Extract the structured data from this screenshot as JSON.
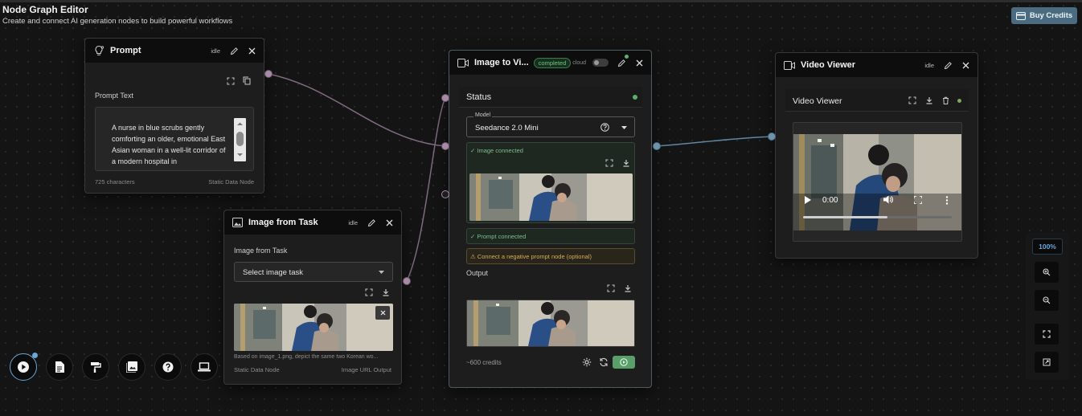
{
  "header": {
    "title": "Node Graph Editor",
    "subtitle": "Create and connect AI generation nodes to build powerful workflows",
    "buy_credits_label": "Buy Credits"
  },
  "prompt_node": {
    "title": "Prompt",
    "status": "idle",
    "section_label": "Prompt Text",
    "text_value": "A nurse in blue scrubs gently comforting an older, emotional East Asian woman in a well-lit corridor of a modern hospital in",
    "char_count": "725 characters",
    "footer_type": "Static Data Node"
  },
  "image_from_task_node": {
    "title": "Image from Task",
    "status": "idle",
    "section_label": "Image from Task",
    "select_value": "Select image task",
    "caption": "Based on image_1.png, depict the same two Korean wo...",
    "footer_left": "Static Data Node",
    "footer_right": "Image URL Output"
  },
  "image_to_video_node": {
    "title": "Image to Vi...",
    "status_badge": "completed",
    "cloud_label": "cloud",
    "status_label": "Status",
    "model_label": "Model",
    "model_value": "Seedance 2.0 Mini",
    "image_connected": "✓ Image connected",
    "prompt_connected": "✓ Prompt connected",
    "negative_prompt_hint": "⚠ Connect a negative prompt node (optional)",
    "output_label": "Output",
    "credits": "~600 credits"
  },
  "video_viewer_node": {
    "title": "Video Viewer",
    "status": "idle",
    "inner_title": "Video Viewer",
    "time": "0:00",
    "playback_fraction": 0.57
  },
  "zoom": {
    "level": "100%"
  },
  "colors": {
    "accent": "#4a6b80",
    "success": "#5fae6e",
    "warning": "#c9a24a",
    "port_pink": "#a88aa8",
    "port_blue": "#6e93ad"
  },
  "dock": {
    "icons": [
      "play-icon",
      "document-icon",
      "paint-roller-icon",
      "image-icon",
      "help-icon",
      "laptop-icon"
    ]
  }
}
